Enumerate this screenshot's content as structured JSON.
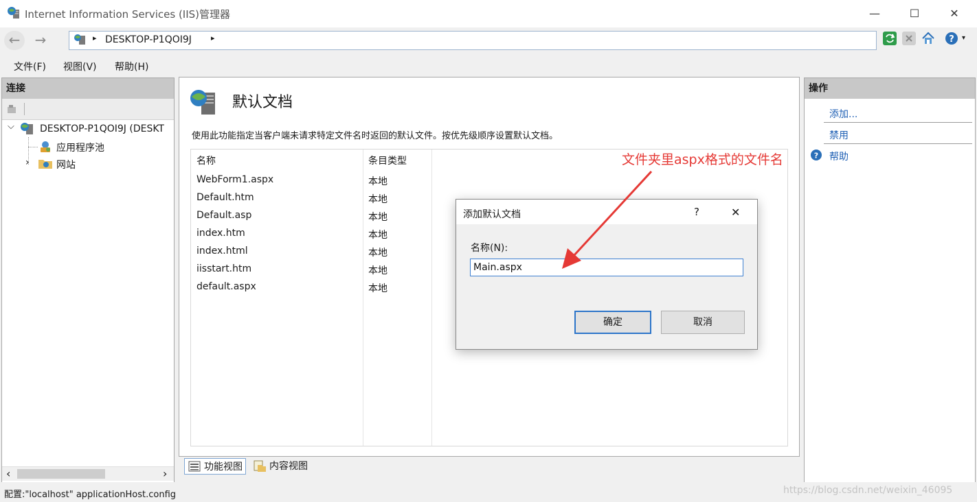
{
  "window": {
    "title": "Internet Information Services (IIS)管理器",
    "minimize_symbol": "—",
    "maximize_symbol": "☐",
    "close_symbol": "✕"
  },
  "address": {
    "back_symbol": "←",
    "forward_symbol": "→",
    "crumb": "DESKTOP-P1QOI9J",
    "separator": "▸"
  },
  "menu": {
    "items": [
      {
        "label": "文件(F)"
      },
      {
        "label": "视图(V)"
      },
      {
        "label": "帮助(H)"
      }
    ]
  },
  "connections": {
    "title": "连接",
    "tree": {
      "server": "DESKTOP-P1QOI9J (DESKT",
      "app_pools": "应用程序池",
      "sites": "网站",
      "expanded_symbol": "⌵",
      "collapsed_symbol": "›"
    },
    "scroll_left": "‹",
    "scroll_right": "›"
  },
  "feature": {
    "title": "默认文档",
    "description": "使用此功能指定当客户端未请求特定文件名时返回的默认文件。按优先级顺序设置默认文档。",
    "columns": {
      "name": "名称",
      "type": "条目类型"
    },
    "rows": [
      {
        "name": "WebForm1.aspx",
        "type": "本地"
      },
      {
        "name": "Default.htm",
        "type": "本地"
      },
      {
        "name": "Default.asp",
        "type": "本地"
      },
      {
        "name": "index.htm",
        "type": "本地"
      },
      {
        "name": "index.html",
        "type": "本地"
      },
      {
        "name": "iisstart.htm",
        "type": "本地"
      },
      {
        "name": "default.aspx",
        "type": "本地"
      }
    ]
  },
  "view_tabs": {
    "features": "功能视图",
    "content": "内容视图"
  },
  "actions": {
    "title": "操作",
    "add": "添加...",
    "disable": "禁用",
    "help": "帮助"
  },
  "status": {
    "text": "配置:\"localhost\" applicationHost.config",
    "watermark": "https://blog.csdn.net/weixin_46095"
  },
  "dialog": {
    "title": "添加默认文档",
    "help_symbol": "?",
    "close_symbol": "✕",
    "name_label": "名称(N):",
    "name_value": "Main.aspx",
    "ok": "确定",
    "cancel": "取消"
  },
  "annotation": {
    "text": "文件夹里aspx格式的文件名"
  },
  "colors": {
    "accent_blue": "#2b74c9",
    "link_blue": "#1e5fb4",
    "annotation_red": "#e53935",
    "panel_header": "#c8c8c8"
  }
}
